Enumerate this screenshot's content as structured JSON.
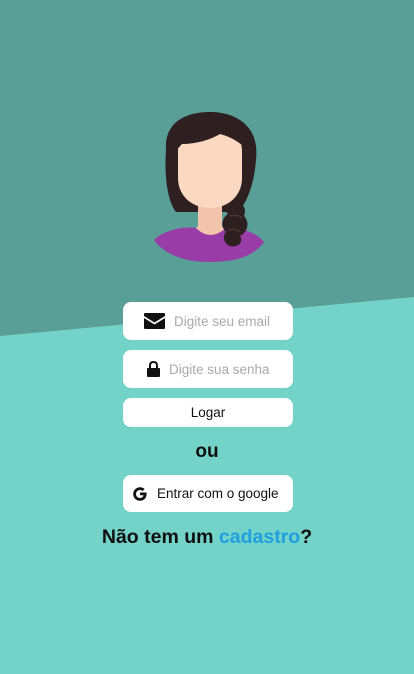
{
  "login": {
    "email_placeholder": "Digite seu email",
    "password_placeholder": "Digite sua senha",
    "login_button": "Logar",
    "separator": "ou",
    "google_button": "Entrar com o google"
  },
  "signup": {
    "prefix": "Não tem um ",
    "link": "cadastro",
    "suffix": "?"
  },
  "icons": {
    "email": "envelope-icon",
    "password": "lock-icon",
    "google": "google-g-icon"
  },
  "colors": {
    "background_top": "#5a9e98",
    "background_bottom": "#74d3c9",
    "link": "#1e9fe0",
    "avatar_shirt": "#9a3ca8",
    "avatar_hair": "#2e2021",
    "avatar_skin": "#fbd8c2"
  }
}
